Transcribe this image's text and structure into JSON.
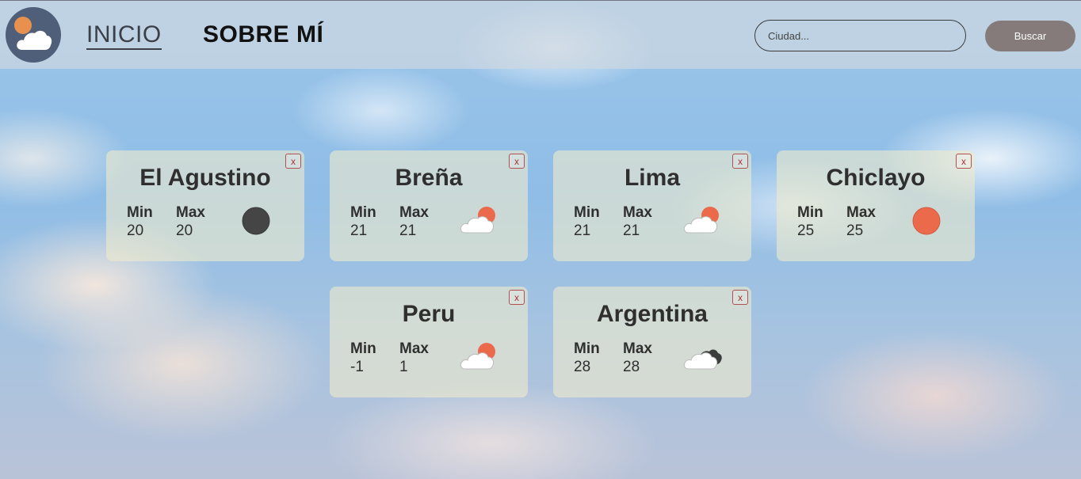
{
  "header": {
    "nav": {
      "inicio": "INICIO",
      "sobre": "SOBRE MÍ"
    },
    "search": {
      "placeholder": "Ciudad...",
      "button_label": "Buscar"
    }
  },
  "cards": [
    {
      "city": "El Agustino",
      "min_label": "Min",
      "max_label": "Max",
      "min": "20",
      "max": "20",
      "icon": "dark-circle-icon",
      "close": "x"
    },
    {
      "city": "Breña",
      "min_label": "Min",
      "max_label": "Max",
      "min": "21",
      "max": "21",
      "icon": "cloud-sun-icon",
      "close": "x"
    },
    {
      "city": "Lima",
      "min_label": "Min",
      "max_label": "Max",
      "min": "21",
      "max": "21",
      "icon": "cloud-sun-icon",
      "close": "x"
    },
    {
      "city": "Chiclayo",
      "min_label": "Min",
      "max_label": "Max",
      "min": "25",
      "max": "25",
      "icon": "sun-icon",
      "close": "x"
    },
    {
      "city": "Peru",
      "min_label": "Min",
      "max_label": "Max",
      "min": "-1",
      "max": "1",
      "icon": "cloud-sun-icon",
      "close": "x"
    },
    {
      "city": "Argentina",
      "min_label": "Min",
      "max_label": "Max",
      "min": "28",
      "max": "28",
      "icon": "cloud-dark-icon",
      "close": "x"
    }
  ],
  "colors": {
    "sun": "#ec6a4c",
    "dark_circle": "#454545",
    "button": "#857b7b"
  }
}
